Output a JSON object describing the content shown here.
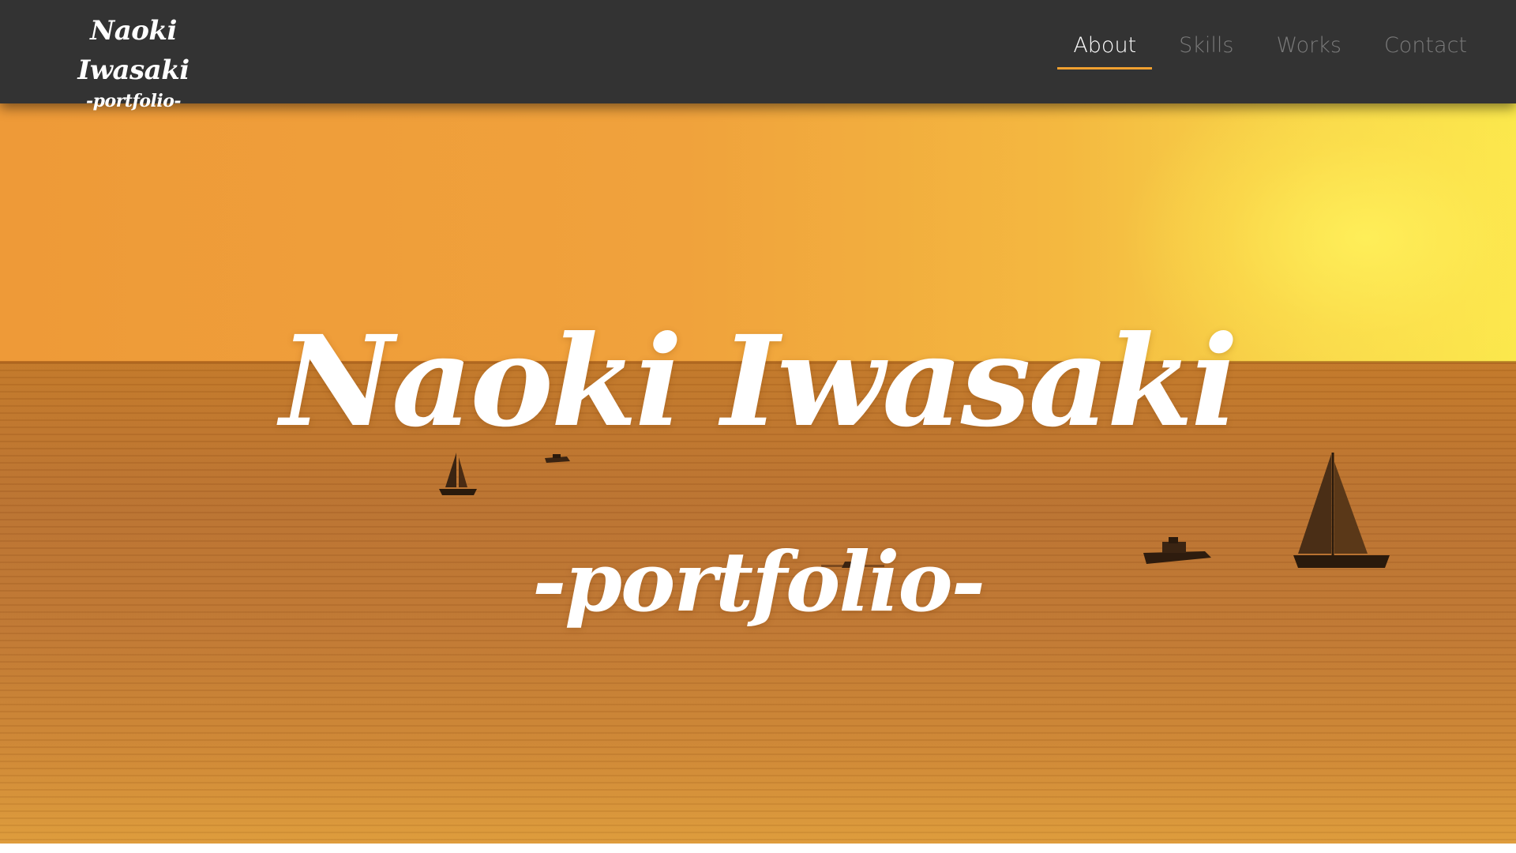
{
  "header": {
    "brand_name": "Naoki Iwasaki",
    "brand_sub": "-portfolio-",
    "nav": [
      {
        "label": "About",
        "active": true
      },
      {
        "label": "Skills",
        "active": false
      },
      {
        "label": "Works",
        "active": false
      },
      {
        "label": "Contact",
        "active": false
      }
    ]
  },
  "hero": {
    "title": "Naoki Iwasaki",
    "subtitle": "-portfolio-"
  },
  "colors": {
    "header_bg": "#333333",
    "nav_active": "#ffffff",
    "nav_inactive": "#7a7a7a",
    "nav_underline": "#f0a030",
    "sky_left": "#ee9a38",
    "sky_right": "#fbe84c",
    "sea": "#b87030"
  }
}
